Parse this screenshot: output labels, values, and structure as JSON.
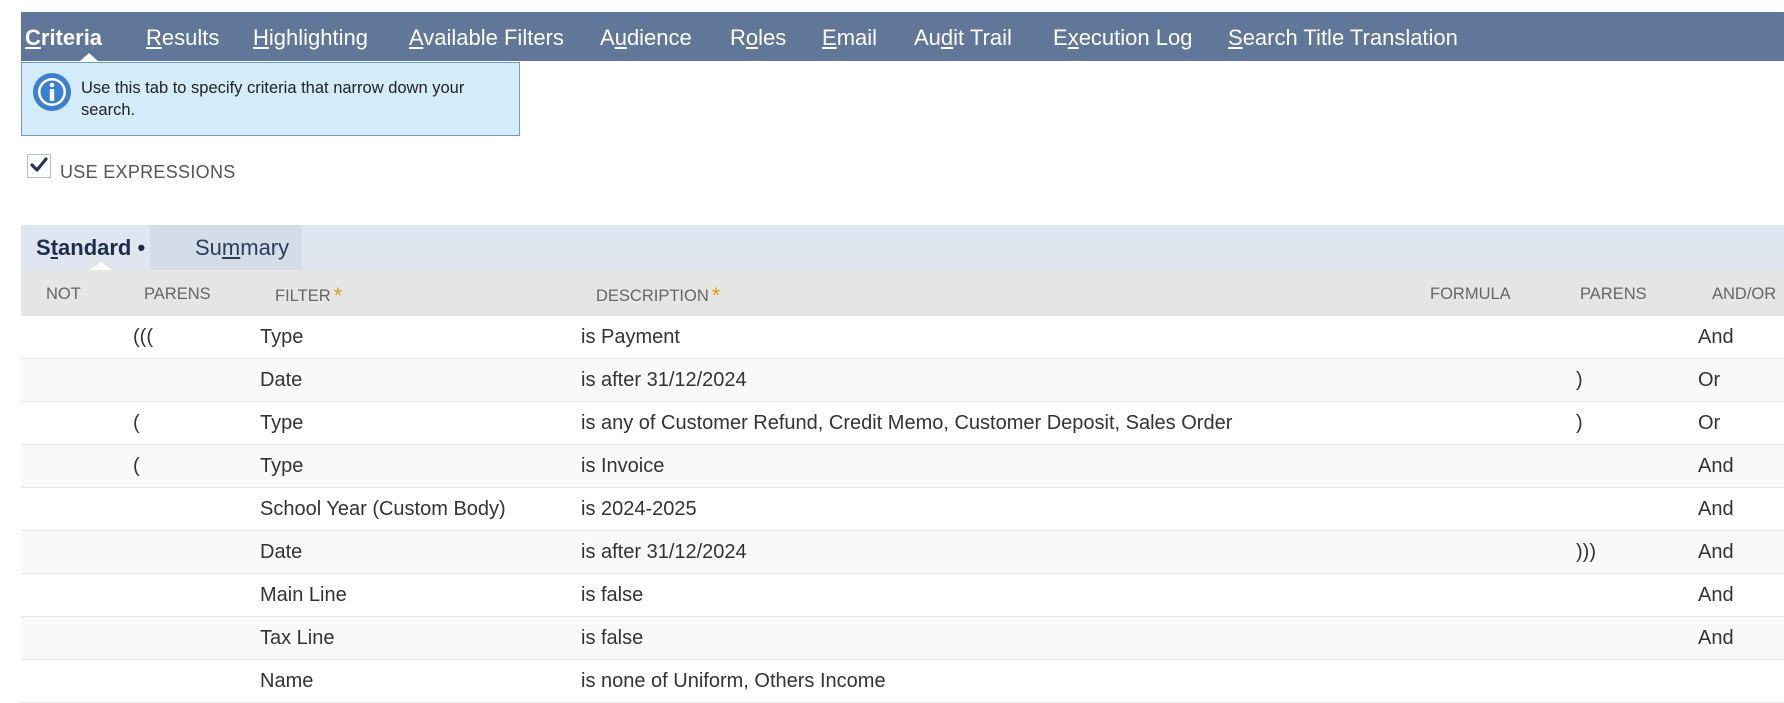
{
  "tabs": [
    {
      "pre": "",
      "u": "C",
      "post": "riteria",
      "active": true
    },
    {
      "pre": "",
      "u": "R",
      "post": "esults"
    },
    {
      "pre": "",
      "u": "H",
      "post": "ighlighting"
    },
    {
      "pre": "",
      "u": "A",
      "post": "vailable Filters"
    },
    {
      "pre": "A",
      "u": "u",
      "post": "dience"
    },
    {
      "pre": "R",
      "u": "o",
      "post": "les"
    },
    {
      "pre": "",
      "u": "E",
      "post": "mail"
    },
    {
      "pre": "Au",
      "u": "d",
      "post": "it Trail"
    },
    {
      "pre": "E",
      "u": "x",
      "post": "ecution Log"
    },
    {
      "pre": "",
      "u": "S",
      "post": "earch Title Translation"
    }
  ],
  "info": {
    "text": "Use this tab to specify criteria that narrow down your search.",
    "icon": "info-icon",
    "bg_color": "#d4ecf9",
    "border_color": "#6d9bc3"
  },
  "use_expressions": {
    "label": "USE EXPRESSIONS",
    "checked": true
  },
  "subtabs": {
    "standard": {
      "pre": "S",
      "u": "t",
      "post": "andard",
      "dot": " •"
    },
    "summary": {
      "pre": "Su",
      "u": "m",
      "post": "mary"
    }
  },
  "columns": {
    "not": "NOT",
    "parens": "PARENS",
    "filter": "FILTER",
    "description": "DESCRIPTION",
    "formula": "FORMULA",
    "parens2": "PARENS",
    "andor": "AND/OR",
    "required_mark": "*"
  },
  "rows": [
    {
      "not": "",
      "parens": "(((",
      "filter": "Type",
      "description": "is Payment",
      "formula": "",
      "parens2": "",
      "andor": "And"
    },
    {
      "not": "",
      "parens": "",
      "filter": "Date",
      "description": "is after 31/12/2024",
      "formula": "",
      "parens2": ")",
      "andor": "Or"
    },
    {
      "not": "",
      "parens": "(",
      "filter": "Type",
      "description": "is any of Customer Refund, Credit Memo, Customer Deposit, Sales Order",
      "formula": "",
      "parens2": ")",
      "andor": "Or"
    },
    {
      "not": "",
      "parens": "(",
      "filter": "Type",
      "description": "is Invoice",
      "formula": "",
      "parens2": "",
      "andor": "And"
    },
    {
      "not": "",
      "parens": "",
      "filter": "School Year (Custom Body)",
      "description": "is 2024-2025",
      "formula": "",
      "parens2": "",
      "andor": "And"
    },
    {
      "not": "",
      "parens": "",
      "filter": "Date",
      "description": "is after 31/12/2024",
      "formula": "",
      "parens2": ")))",
      "andor": "And"
    },
    {
      "not": "",
      "parens": "",
      "filter": "Main Line",
      "description": "is false",
      "formula": "",
      "parens2": "",
      "andor": "And"
    },
    {
      "not": "",
      "parens": "",
      "filter": "Tax Line",
      "description": "is false",
      "formula": "",
      "parens2": "",
      "andor": "And"
    },
    {
      "not": "",
      "parens": "",
      "filter": "Name",
      "description": "is none of Uniform, Others Income",
      "formula": "",
      "parens2": "",
      "andor": ""
    }
  ],
  "colors": {
    "tabbar": "#607799",
    "accent_star": "#e39a1b",
    "subtab_bg": "#e0e6ef",
    "header_bg": "#e5e5e5"
  }
}
